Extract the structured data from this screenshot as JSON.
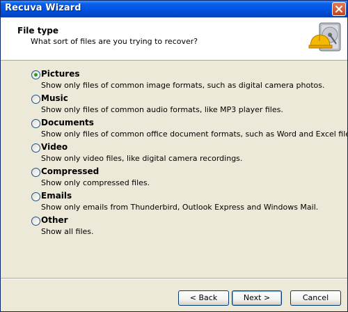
{
  "window": {
    "title": "Recuva Wizard",
    "accent_color": "#0054e3",
    "close_icon": "close-icon"
  },
  "header": {
    "title": "File type",
    "subtitle": "What sort of files are you trying to recover?",
    "icon": "hard-drive-hardhat-icon"
  },
  "options": [
    {
      "label": "Pictures",
      "description": "Show only files of common image formats, such as digital camera photos.",
      "selected": true
    },
    {
      "label": "Music",
      "description": "Show only files of common audio formats, like MP3 player files.",
      "selected": false
    },
    {
      "label": "Documents",
      "description": "Show only files of common office document formats, such as Word and Excel files.",
      "selected": false
    },
    {
      "label": "Video",
      "description": "Show only video files, like digital camera recordings.",
      "selected": false
    },
    {
      "label": "Compressed",
      "description": "Show only compressed files.",
      "selected": false
    },
    {
      "label": "Emails",
      "description": "Show only emails from Thunderbird, Outlook Express and Windows Mail.",
      "selected": false
    },
    {
      "label": "Other",
      "description": "Show all files.",
      "selected": false
    }
  ],
  "buttons": {
    "back": "< Back",
    "next": "Next >",
    "cancel": "Cancel"
  }
}
